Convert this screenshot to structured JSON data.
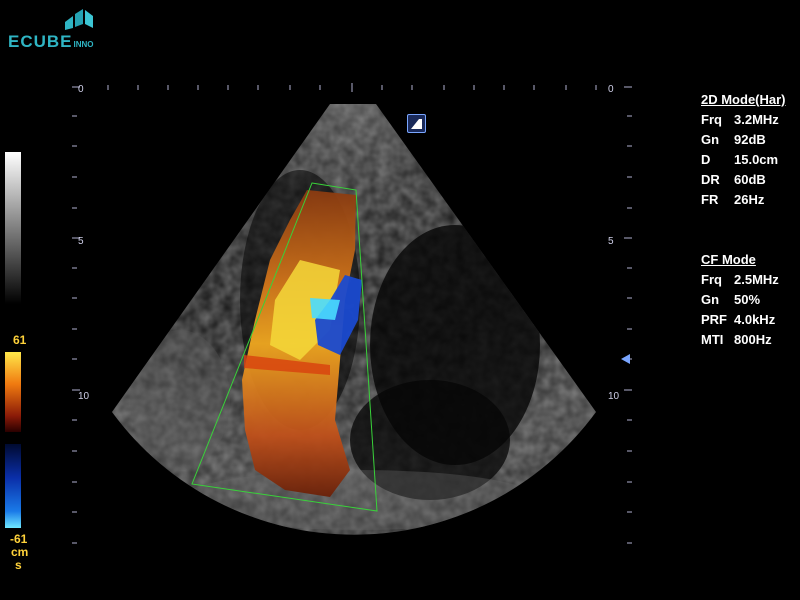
{
  "logo": {
    "main": "ECUBE",
    "sub": "INNO"
  },
  "depth_scale": {
    "left_labels": [
      "0",
      "5",
      "10"
    ],
    "right_labels": [
      "0",
      "5",
      "10"
    ]
  },
  "mode_icon": "trapezoid-mode-icon",
  "color_bar": {
    "max_label": "61",
    "min_label": "-61",
    "unit_line1": "cm",
    "unit_line2": "s"
  },
  "mode_2d": {
    "title": "2D Mode(Har)",
    "params": [
      {
        "key": "Frq",
        "value": "3.2MHz"
      },
      {
        "key": "Gn",
        "value": "92dB"
      },
      {
        "key": "D",
        "value": "15.0cm"
      },
      {
        "key": "DR",
        "value": "60dB"
      },
      {
        "key": "FR",
        "value": "26Hz"
      }
    ]
  },
  "mode_cf": {
    "title": "CF Mode",
    "params": [
      {
        "key": "Frq",
        "value": "2.5MHz"
      },
      {
        "key": "Gn",
        "value": "50%"
      },
      {
        "key": "PRF",
        "value": "4.0kHz"
      },
      {
        "key": "MTI",
        "value": "800Hz"
      }
    ]
  },
  "colors": {
    "logo": "#2fb5c4",
    "roi_box": "#39d23a",
    "bar_label": "#ffd23a"
  }
}
